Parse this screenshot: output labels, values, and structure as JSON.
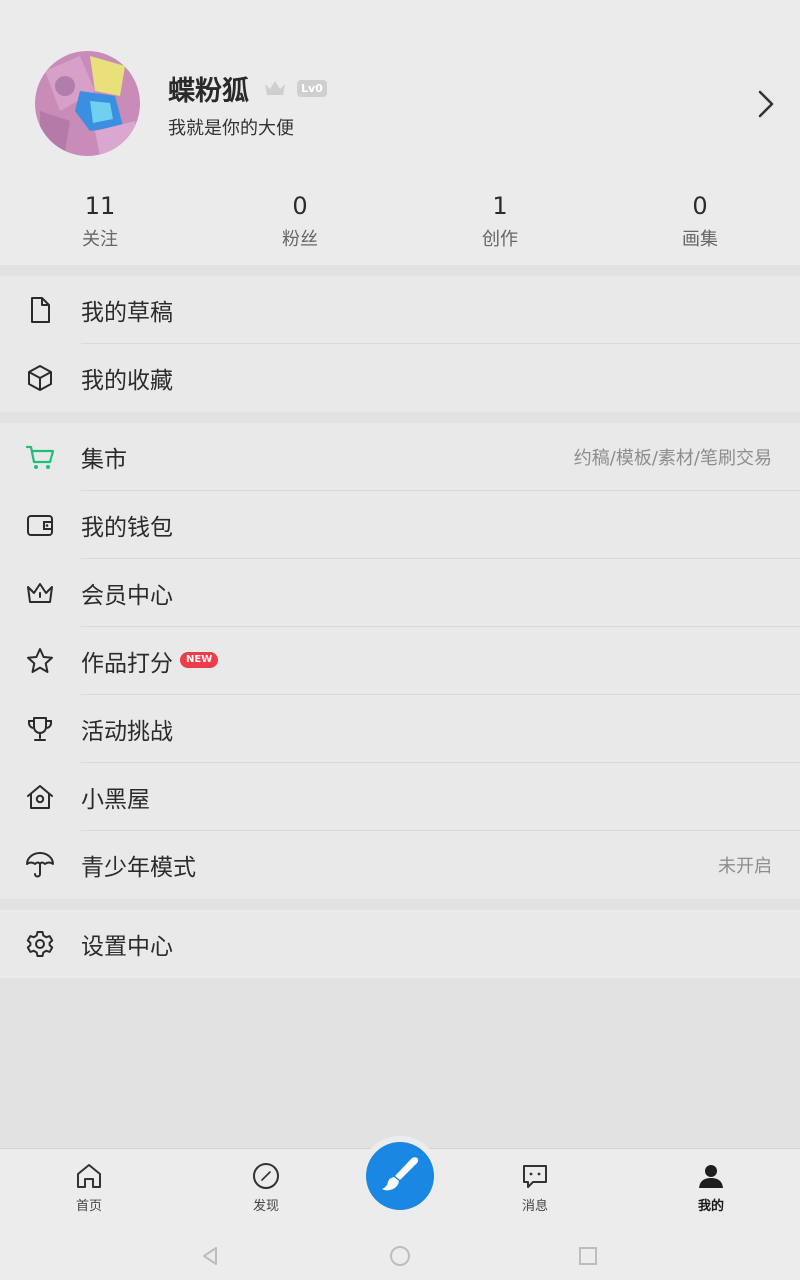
{
  "profile": {
    "nickname": "蝶粉狐",
    "level_badge": "Lv0",
    "bio": "我就是你的大便",
    "stats": [
      {
        "value": "11",
        "label": "关注"
      },
      {
        "value": "0",
        "label": "粉丝"
      },
      {
        "value": "1",
        "label": "创作"
      },
      {
        "value": "0",
        "label": "画集"
      }
    ]
  },
  "menu": {
    "group1": [
      {
        "label": "我的草稿",
        "icon": "document-icon"
      },
      {
        "label": "我的收藏",
        "icon": "box-icon"
      }
    ],
    "group2": [
      {
        "label": "集市",
        "icon": "cart-icon",
        "right": "约稿/模板/素材/笔刷交易"
      },
      {
        "label": "我的钱包",
        "icon": "wallet-icon"
      },
      {
        "label": "会员中心",
        "icon": "crown-icon"
      },
      {
        "label": "作品打分",
        "icon": "star-icon",
        "badge": "NEW"
      },
      {
        "label": "活动挑战",
        "icon": "trophy-icon"
      },
      {
        "label": "小黑屋",
        "icon": "house-icon"
      },
      {
        "label": "青少年模式",
        "icon": "umbrella-icon",
        "right": "未开启"
      }
    ],
    "group3": [
      {
        "label": "设置中心",
        "icon": "gear-icon"
      }
    ]
  },
  "bottom_nav": [
    {
      "label": "首页",
      "icon": "home-icon"
    },
    {
      "label": "发现",
      "icon": "compass-icon"
    },
    {
      "label": "消息",
      "icon": "message-icon"
    },
    {
      "label": "我的",
      "icon": "person-icon",
      "active": true
    }
  ],
  "colors": {
    "accent_blue": "#1a88e2",
    "cart_green": "#1fbf7a",
    "new_badge": "#ef3c4a"
  }
}
